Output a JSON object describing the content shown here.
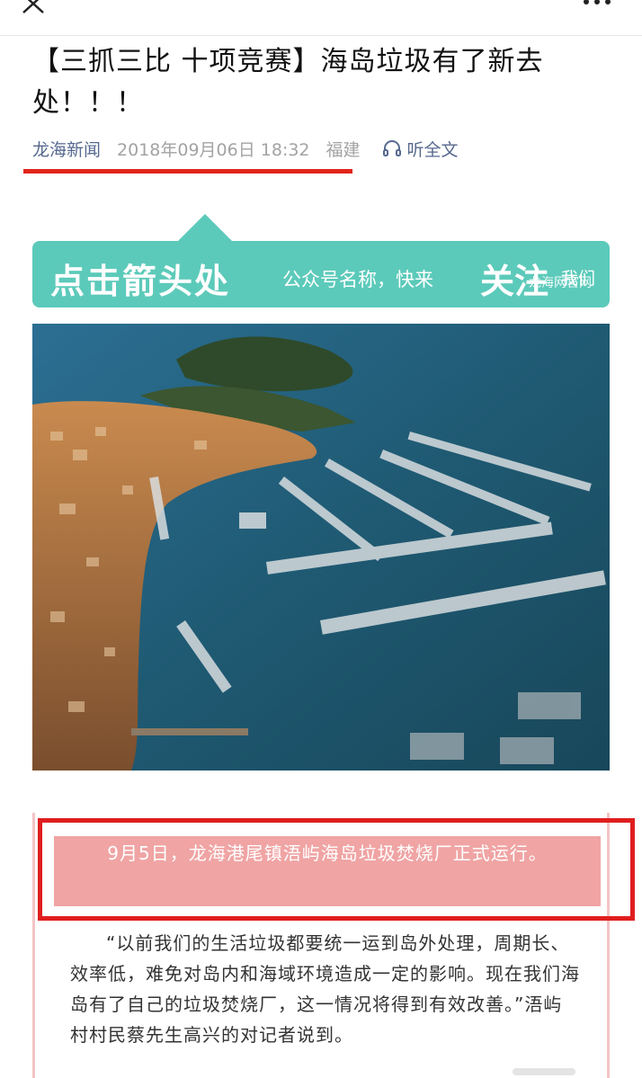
{
  "title": "【三抓三比 十项竞赛】海岛垃圾有了新去处！！！",
  "meta": {
    "source": "龙海新闻",
    "date": "2018年09月06日 18:32",
    "region": "福建",
    "listen": "听全文"
  },
  "banner": {
    "part1": "点击箭头处",
    "part2": "公众号名称，快来",
    "part3": "关注",
    "part4": "我们",
    "watermark": "龙海网官网"
  },
  "caption": "9月5日，龙海港尾镇浯屿海岛垃圾焚烧厂正式运行。",
  "body": "“以前我们的生活垃圾都要统一运到岛外处理，周期长、效率低，难免对岛内和海域环境造成一定的影响。现在我们海岛有了自己的垃圾焚烧厂，这一情况将得到有效改善。”浯屿村村民蔡先生高兴的对记者说到。",
  "colors": {
    "accent_red": "#e1251b",
    "source_blue": "#56698f",
    "banner_teal": "#5ccaba",
    "caption_pink": "#f0a4a4"
  },
  "icons": [
    "close-icon",
    "more-icon",
    "headphones-icon"
  ]
}
